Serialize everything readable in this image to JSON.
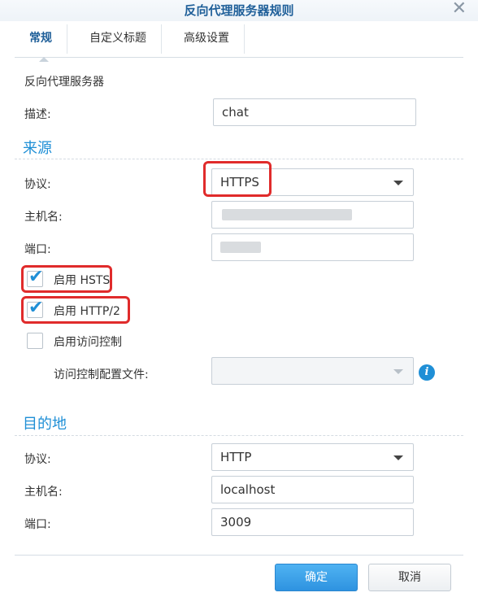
{
  "dialog": {
    "title": "反向代理服务器规则"
  },
  "tabs": [
    {
      "label": "常规"
    },
    {
      "label": "自定义标题"
    },
    {
      "label": "高级设置"
    }
  ],
  "general": {
    "heading": "反向代理服务器",
    "description_label": "描述:",
    "description_value": "chat"
  },
  "source": {
    "heading": "来源",
    "protocol_label": "协议:",
    "protocol_value": "HTTPS",
    "hostname_label": "主机名:",
    "port_label": "端口:",
    "hsts_label": "启用 HSTS",
    "hsts_checked": true,
    "http2_label": "启用 HTTP/2",
    "http2_checked": true,
    "access_control_label": "启用访问控制",
    "access_control_checked": false,
    "access_profile_label": "访问控制配置文件:"
  },
  "destination": {
    "heading": "目的地",
    "protocol_label": "协议:",
    "protocol_value": "HTTP",
    "hostname_label": "主机名:",
    "hostname_value": "localhost",
    "port_label": "端口:",
    "port_value": "3009"
  },
  "buttons": {
    "ok": "确定",
    "cancel": "取消"
  },
  "colors": {
    "accent": "#1f8fd6",
    "title": "#1f5f99",
    "highlight_box": "#e02b2b"
  }
}
